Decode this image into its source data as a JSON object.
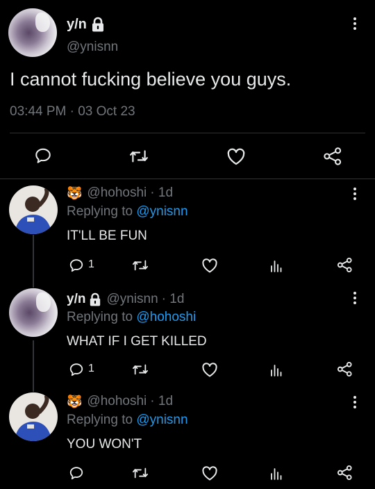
{
  "main_tweet": {
    "display_name": "y/n",
    "handle": "@ynisnn",
    "text": "I cannot fucking believe you guys.",
    "timestamp": "03:44 PM · 03 Oct 23",
    "protected": true
  },
  "replies": [
    {
      "display_name_emoji": "🐯",
      "handle": "@hohoshi",
      "age": "· 1d",
      "replying_prefix": "Replying to",
      "replying_to": "@ynisnn",
      "text": "IT'LL BE FUN",
      "reply_count": "1"
    },
    {
      "display_name": "y/n",
      "handle": "@ynisnn",
      "age": "· 1d",
      "replying_prefix": "Replying to",
      "replying_to": "@hohoshi",
      "text": "WHAT IF I GET KILLED",
      "reply_count": "1"
    },
    {
      "display_name_emoji": "🐯",
      "handle": "@hohoshi",
      "age": "· 1d",
      "replying_prefix": "Replying to",
      "replying_to": "@ynisnn",
      "text": "YOU WON'T",
      "reply_count": ""
    }
  ],
  "colors": {
    "background": "#000000",
    "text": "#e7e9ea",
    "muted": "#71767b",
    "link": "#1d9bf0",
    "divider": "#2f3336"
  },
  "icons": [
    "more-icon",
    "lock-icon",
    "reply-icon",
    "retweet-icon",
    "like-icon",
    "share-icon",
    "analytics-icon"
  ]
}
